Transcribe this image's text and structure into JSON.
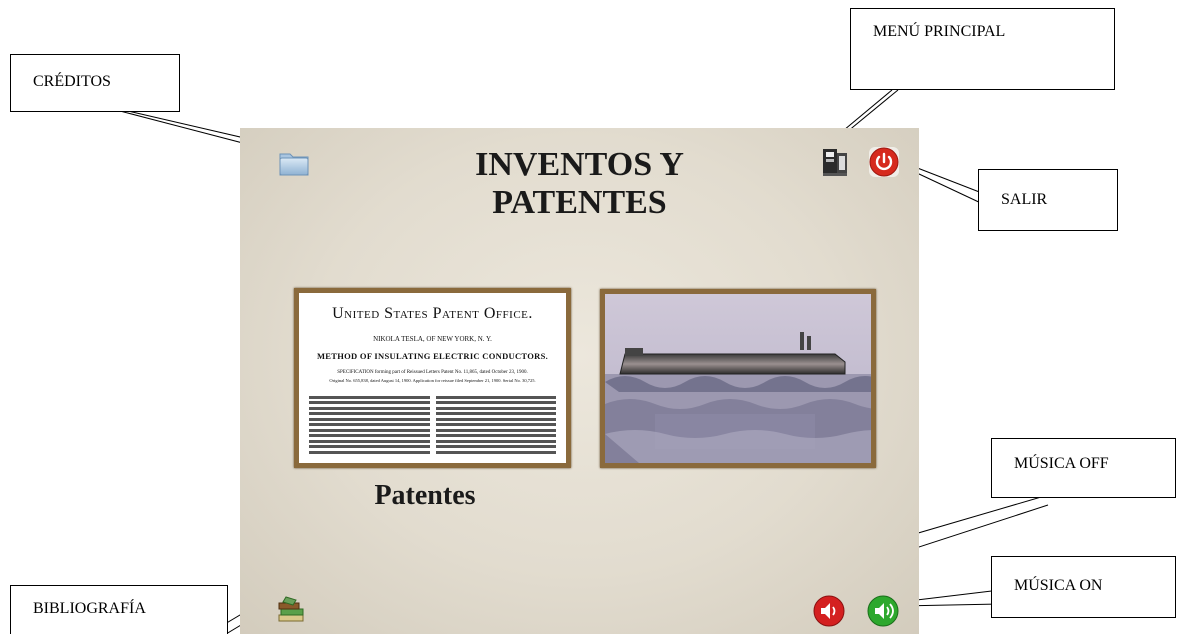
{
  "title": {
    "line1": "INVENTOS Y",
    "line2": "PATENTES"
  },
  "caption": "Patentes",
  "patent_doc": {
    "office": "United States Patent Office.",
    "author": "NIKOLA TESLA, OF NEW YORK, N. Y.",
    "heading": "METHOD OF INSULATING ELECTRIC CONDUCTORS.",
    "spec": "SPECIFICATION forming part of Reissued Letters Patent No. 11,865, dated October 23, 1900.",
    "original": "Original No. 655,838, dated August 14, 1900. Application for reissue filed September 21, 1900. Serial No. 30,725."
  },
  "callouts": {
    "creditos": "CRÉDITOS",
    "menu_principal": "MENÚ PRINCIPAL",
    "salir": "SALIR",
    "musica_off": "MÚSICA OFF",
    "musica_on": "MÚSICA ON",
    "bibliografia": "BIBLIOGRAFÍA"
  },
  "icons": {
    "credits": "folder-icon",
    "menu": "menu-icon",
    "exit": "power-icon",
    "music_off": "speaker-off-icon",
    "music_on": "speaker-on-icon",
    "bibliography": "books-icon"
  },
  "colors": {
    "frame": "#8a6a3c",
    "exit": "#d62a1e",
    "music_off": "#d42020",
    "music_on": "#2da82d"
  }
}
